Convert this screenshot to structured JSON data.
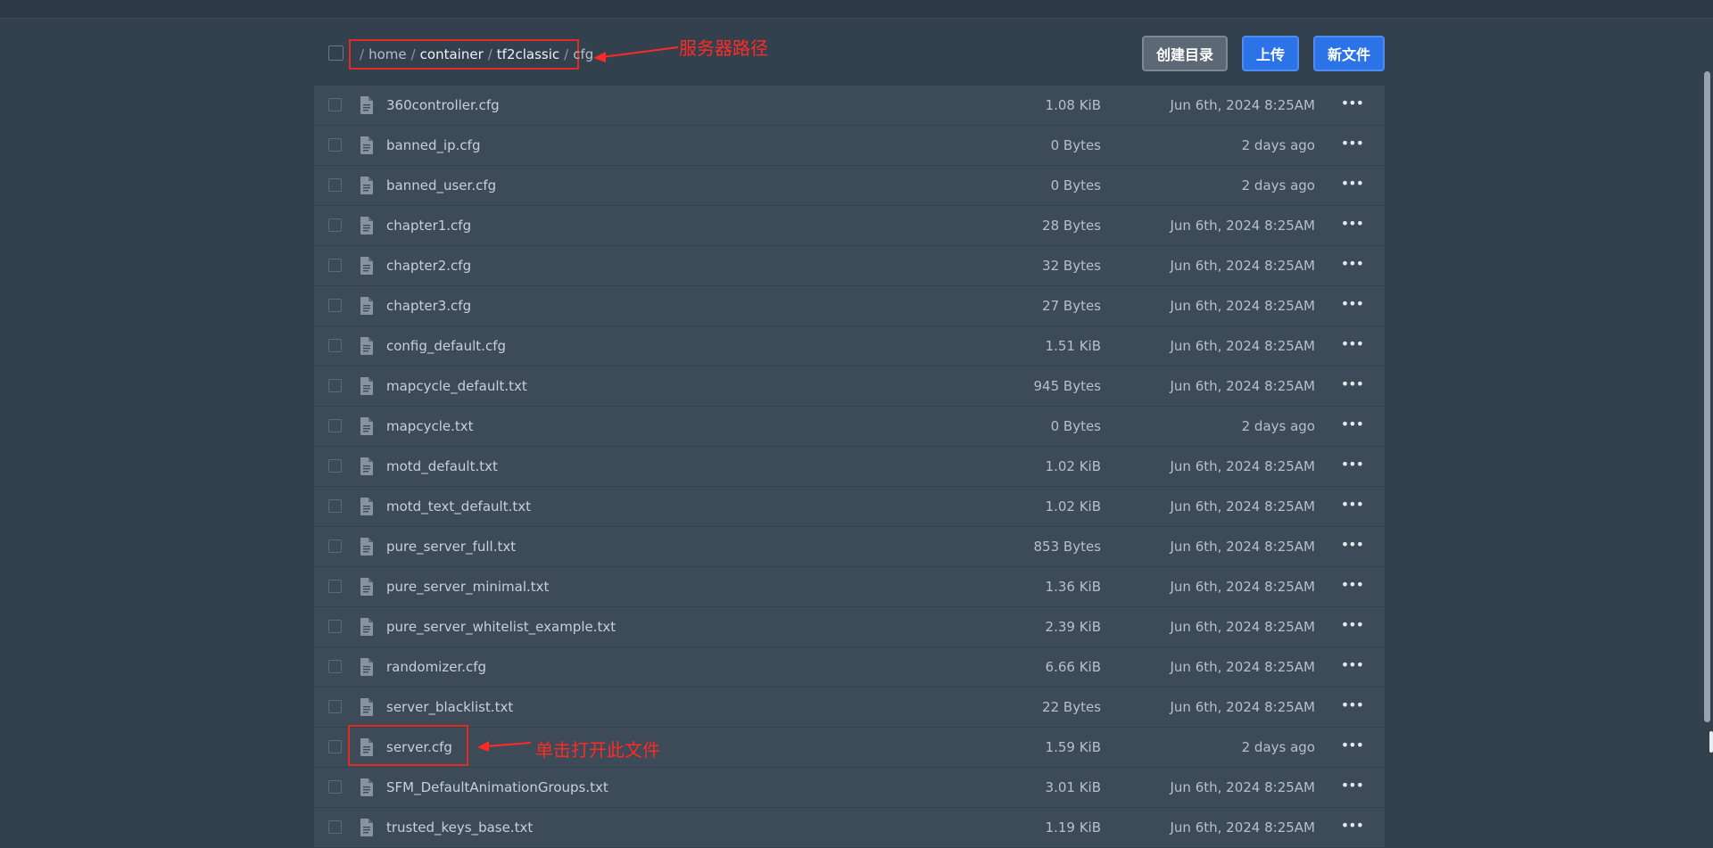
{
  "breadcrumb": [
    {
      "text": "home",
      "style": "dim"
    },
    {
      "text": "container",
      "style": "strong"
    },
    {
      "text": "tf2classic",
      "style": "strong"
    },
    {
      "text": "cfg",
      "style": "dim"
    }
  ],
  "breadcrumb_separator": "/",
  "annotations": {
    "path_label": "服务器路径",
    "open_label": "单击打开此文件",
    "color": "#ff2b24"
  },
  "buttons": {
    "mkdir_label": "创建目录",
    "upload_label": "上传",
    "new_file_label": "新文件"
  },
  "more_glyph": "•••",
  "files": [
    {
      "name": "360controller.cfg",
      "size": "1.08 KiB",
      "date": "Jun 6th, 2024 8:25AM"
    },
    {
      "name": "banned_ip.cfg",
      "size": "0 Bytes",
      "date": "2 days ago"
    },
    {
      "name": "banned_user.cfg",
      "size": "0 Bytes",
      "date": "2 days ago"
    },
    {
      "name": "chapter1.cfg",
      "size": "28 Bytes",
      "date": "Jun 6th, 2024 8:25AM"
    },
    {
      "name": "chapter2.cfg",
      "size": "32 Bytes",
      "date": "Jun 6th, 2024 8:25AM"
    },
    {
      "name": "chapter3.cfg",
      "size": "27 Bytes",
      "date": "Jun 6th, 2024 8:25AM"
    },
    {
      "name": "config_default.cfg",
      "size": "1.51 KiB",
      "date": "Jun 6th, 2024 8:25AM"
    },
    {
      "name": "mapcycle_default.txt",
      "size": "945 Bytes",
      "date": "Jun 6th, 2024 8:25AM"
    },
    {
      "name": "mapcycle.txt",
      "size": "0 Bytes",
      "date": "2 days ago"
    },
    {
      "name": "motd_default.txt",
      "size": "1.02 KiB",
      "date": "Jun 6th, 2024 8:25AM"
    },
    {
      "name": "motd_text_default.txt",
      "size": "1.02 KiB",
      "date": "Jun 6th, 2024 8:25AM"
    },
    {
      "name": "pure_server_full.txt",
      "size": "853 Bytes",
      "date": "Jun 6th, 2024 8:25AM"
    },
    {
      "name": "pure_server_minimal.txt",
      "size": "1.36 KiB",
      "date": "Jun 6th, 2024 8:25AM"
    },
    {
      "name": "pure_server_whitelist_example.txt",
      "size": "2.39 KiB",
      "date": "Jun 6th, 2024 8:25AM"
    },
    {
      "name": "randomizer.cfg",
      "size": "6.66 KiB",
      "date": "Jun 6th, 2024 8:25AM"
    },
    {
      "name": "server_blacklist.txt",
      "size": "22 Bytes",
      "date": "Jun 6th, 2024 8:25AM"
    },
    {
      "name": "server.cfg",
      "size": "1.59 KiB",
      "date": "2 days ago",
      "highlighted": true
    },
    {
      "name": "SFM_DefaultAnimationGroups.txt",
      "size": "3.01 KiB",
      "date": "Jun 6th, 2024 8:25AM"
    },
    {
      "name": "trusted_keys_base.txt",
      "size": "1.19 KiB",
      "date": "Jun 6th, 2024 8:25AM"
    }
  ]
}
